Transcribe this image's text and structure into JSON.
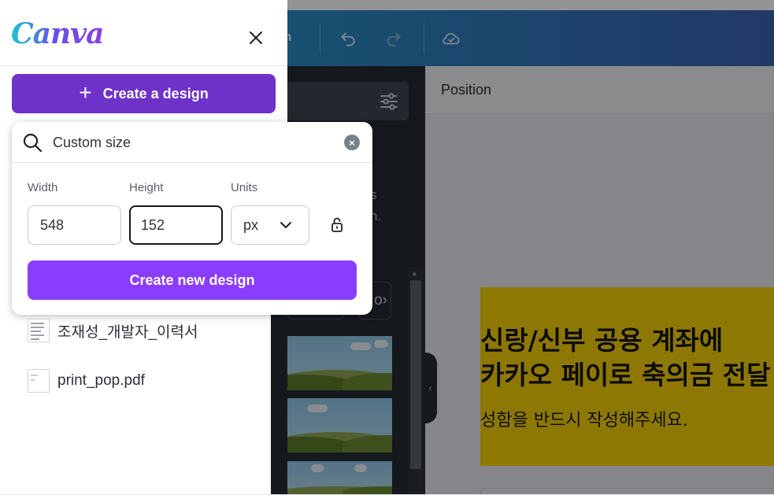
{
  "toolbar": {
    "share_fragment": "h"
  },
  "menu": {
    "logo": "Canva",
    "create_label": "Create a design"
  },
  "popup": {
    "search_value": "Custom size",
    "width_label": "Width",
    "height_label": "Height",
    "units_label": "Units",
    "width_value": "548",
    "height_value": "152",
    "units_value": "px",
    "submit_label": "Create new design"
  },
  "recent_files": [
    {
      "name": "조재성_개발자_이력서"
    },
    {
      "name": "print_pop.pdf"
    }
  ],
  "side_panel": {
    "frag1": "s",
    "frag2": "n.",
    "frag3": "o"
  },
  "editor": {
    "position_label": "Position",
    "design_title": "신랑/신부 공용 계좌에\n카카오 페이로 축의금 전달",
    "design_subtitle": "성함을 반드시 작성해주세요."
  },
  "colors": {
    "brand_purple": "#8b3dff",
    "create_purple": "#6e32c8",
    "design_yellow": "#f5cf08"
  }
}
